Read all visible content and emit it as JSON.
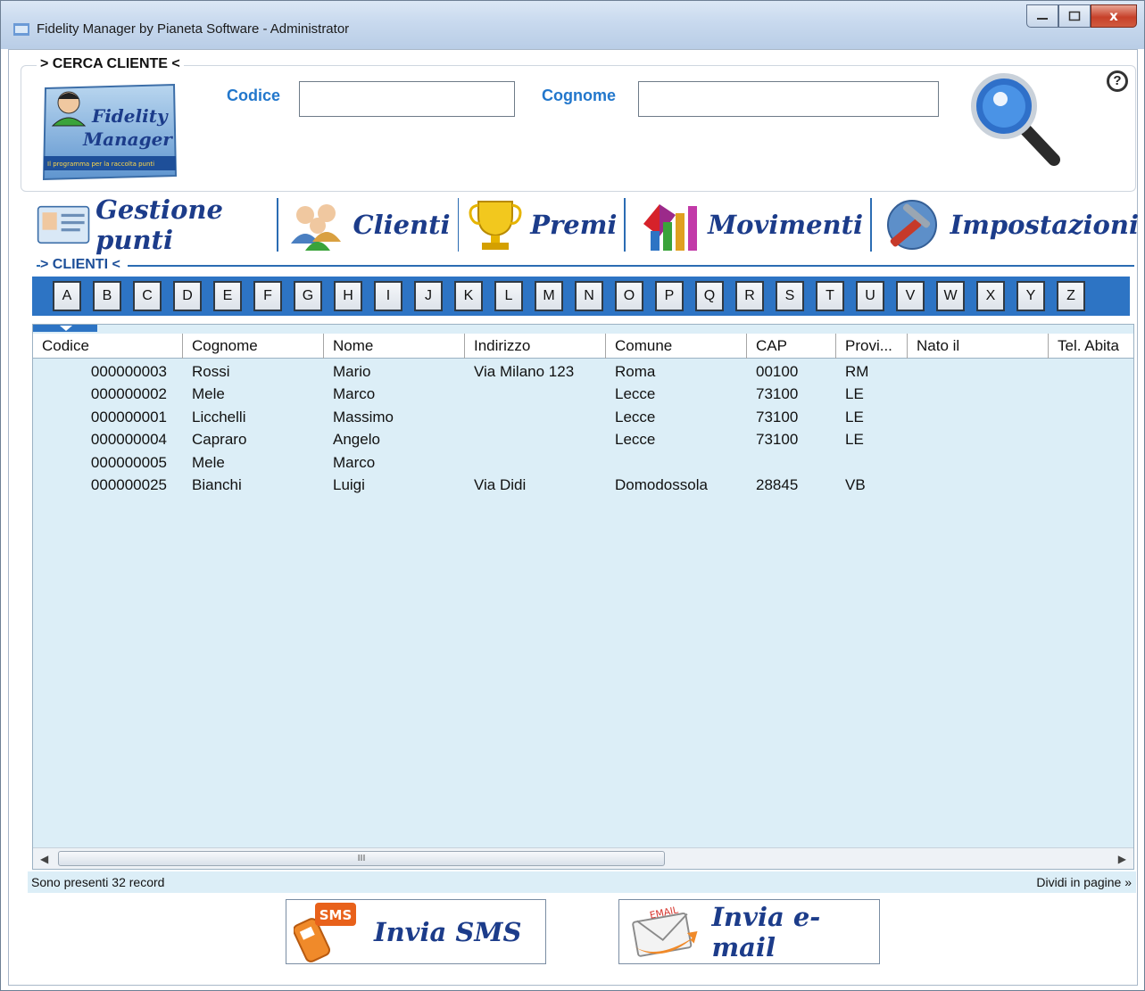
{
  "window": {
    "title": "Fidelity Manager by Pianeta Software - Administrator",
    "close_label": "x"
  },
  "search": {
    "section_label": "> CERCA CLIENTE <",
    "codice_label": "Codice",
    "codice_value": "",
    "cognome_label": "Cognome",
    "cognome_value": "",
    "help_label": "?",
    "logo_text_line1": "Fidelity",
    "logo_text_line2": "Manager",
    "logo_tagline": "Il programma per la raccolta punti"
  },
  "menu": {
    "items": [
      {
        "label": "Gestione punti",
        "icon": "card-icon"
      },
      {
        "label": "Clienti",
        "icon": "users-icon"
      },
      {
        "label": "Premi",
        "icon": "trophy-icon"
      },
      {
        "label": "Movimenti",
        "icon": "chart-icon"
      },
      {
        "label": "Impostazioni",
        "icon": "tools-icon"
      }
    ]
  },
  "clienti": {
    "section_label": "> CLIENTI <",
    "letters": [
      "A",
      "B",
      "C",
      "D",
      "E",
      "F",
      "G",
      "H",
      "I",
      "J",
      "K",
      "L",
      "M",
      "N",
      "O",
      "P",
      "Q",
      "R",
      "S",
      "T",
      "U",
      "V",
      "W",
      "X",
      "Y",
      "Z"
    ],
    "columns": [
      "Codice",
      "Cognome",
      "Nome",
      "Indirizzo",
      "Comune",
      "CAP",
      "Provi...",
      "Nato il",
      "Tel. Abita"
    ],
    "rows": [
      [
        "000000003",
        "Rossi",
        "Mario",
        "Via Milano 123",
        "Roma",
        "00100",
        "RM",
        "",
        ""
      ],
      [
        "000000002",
        "Mele",
        "Marco",
        "",
        "Lecce",
        "73100",
        "LE",
        "",
        ""
      ],
      [
        "000000001",
        "Licchelli",
        "Massimo",
        "",
        "Lecce",
        "73100",
        "LE",
        "",
        ""
      ],
      [
        "000000004",
        "Capraro",
        "Angelo",
        "",
        "Lecce",
        "73100",
        "LE",
        "",
        ""
      ],
      [
        "000000005",
        "Mele",
        "Marco",
        "",
        "",
        "",
        "",
        "",
        ""
      ],
      [
        "000000025",
        "Bianchi",
        "Luigi",
        "Via Didi",
        "Domodossola",
        "28845",
        "VB",
        "",
        ""
      ]
    ],
    "scroll_thumb_label": "III"
  },
  "status": {
    "record_count": "Sono presenti 32 record",
    "paginate_link": "Dividi in pagine »"
  },
  "actions": {
    "sms_label": "Invia SMS",
    "sms_badge": "SMS",
    "email_label": "Invia e-mail",
    "email_badge": "EMAIL"
  },
  "colors": {
    "accent_blue": "#2d74c4",
    "label_blue": "#2277cc",
    "menu_text": "#1c3c8a",
    "grid_bg": "#dceef7"
  }
}
